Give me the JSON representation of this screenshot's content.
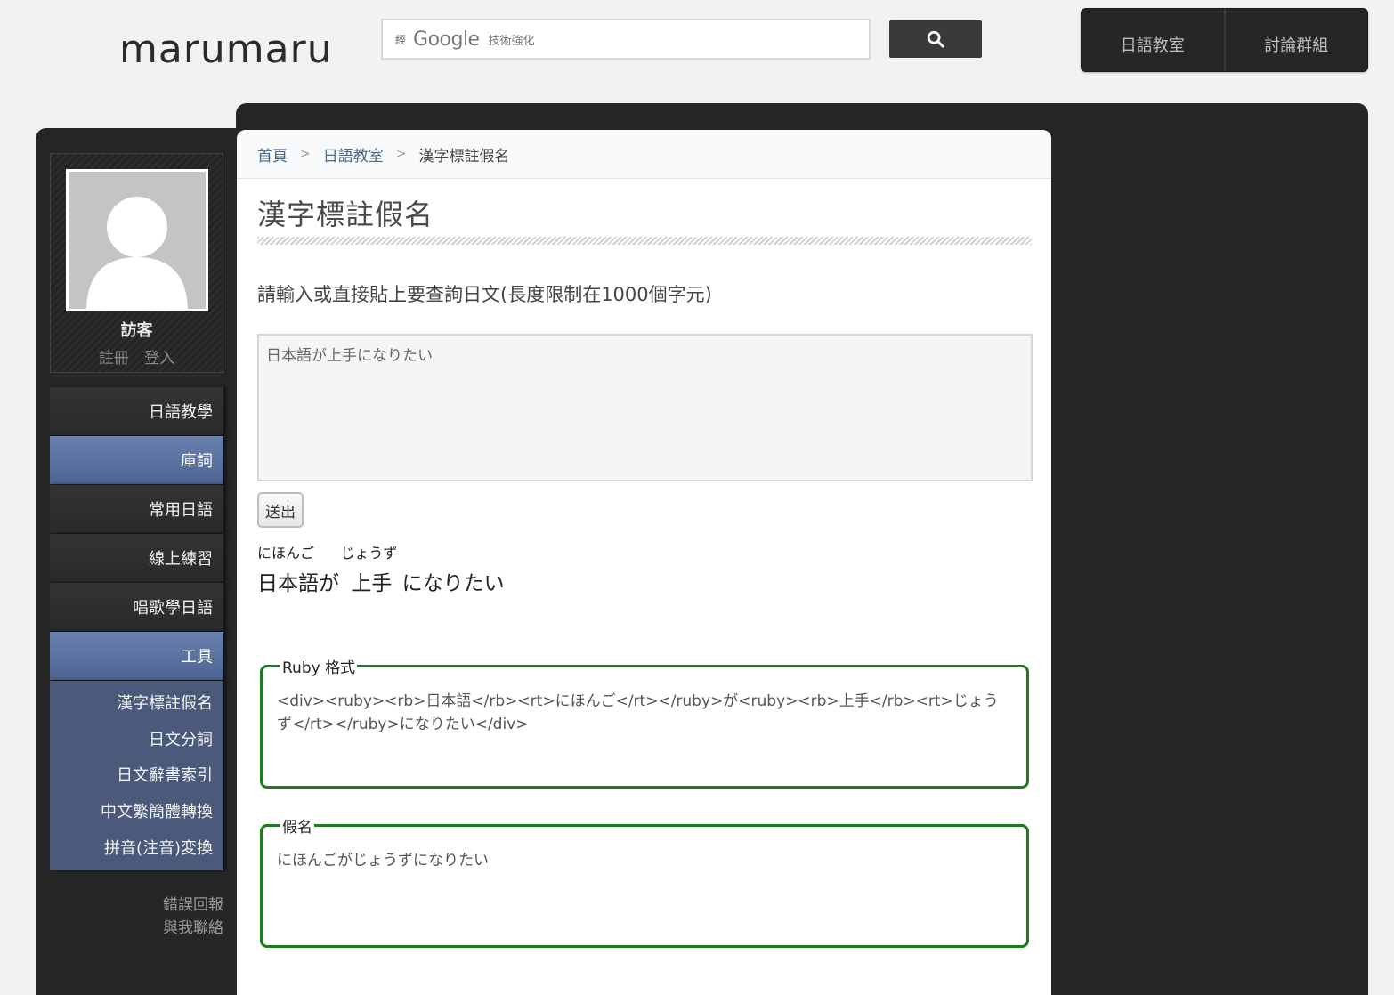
{
  "header": {
    "logo": "marumaru",
    "search": {
      "prefix": "經",
      "brand": "Google",
      "suffix": "技術強化"
    },
    "nav": [
      "日語教室",
      "討論群組"
    ]
  },
  "profile": {
    "name": "訪客",
    "register": "註冊",
    "login": "登入"
  },
  "sidebar": {
    "items": [
      {
        "label": "日語教學"
      },
      {
        "label": "庫詞"
      },
      {
        "label": "常用日語"
      },
      {
        "label": "線上練習"
      },
      {
        "label": "唱歌學日語"
      },
      {
        "label": "工具"
      }
    ],
    "subitems": [
      {
        "label": "漢字標註假名"
      },
      {
        "label": "日文分詞"
      },
      {
        "label": "日文辭書索引"
      },
      {
        "label": "中文繁簡體轉換"
      },
      {
        "label": "拼音(注音)変換"
      }
    ],
    "footer": [
      "錯誤回報",
      "與我聯絡"
    ]
  },
  "breadcrumb": [
    "首頁",
    "日語教室",
    "漢字標註假名"
  ],
  "main": {
    "title": "漢字標註假名",
    "instruction": "請輸入或直接貼上要查詢日文(長度限制在1000個字元)",
    "input_value": "日本語が上手になりたい",
    "submit_label": "送出",
    "ruby": {
      "seg1_base": "日本語",
      "seg1_reading": "にほんご",
      "seg2_plain": "が",
      "seg3_base": "上手",
      "seg3_reading": "じょうず",
      "seg4_plain": "になりたい"
    },
    "ruby_box": {
      "legend": "Ruby 格式",
      "code": "<div><ruby><rb>日本語</rb><rt>にほんご</rt></ruby>が<ruby><rb>上手</rb><rt>じょうず</rt></ruby>になりたい</div>"
    },
    "kana_box": {
      "legend": "假名",
      "text": "にほんごがじょうずになりたい"
    }
  },
  "colors": {
    "frame": "#262626",
    "menu_blue": "#5b70a0",
    "submenu_bg": "#4b5a7a",
    "fieldset_border": "#1e7a1e"
  }
}
